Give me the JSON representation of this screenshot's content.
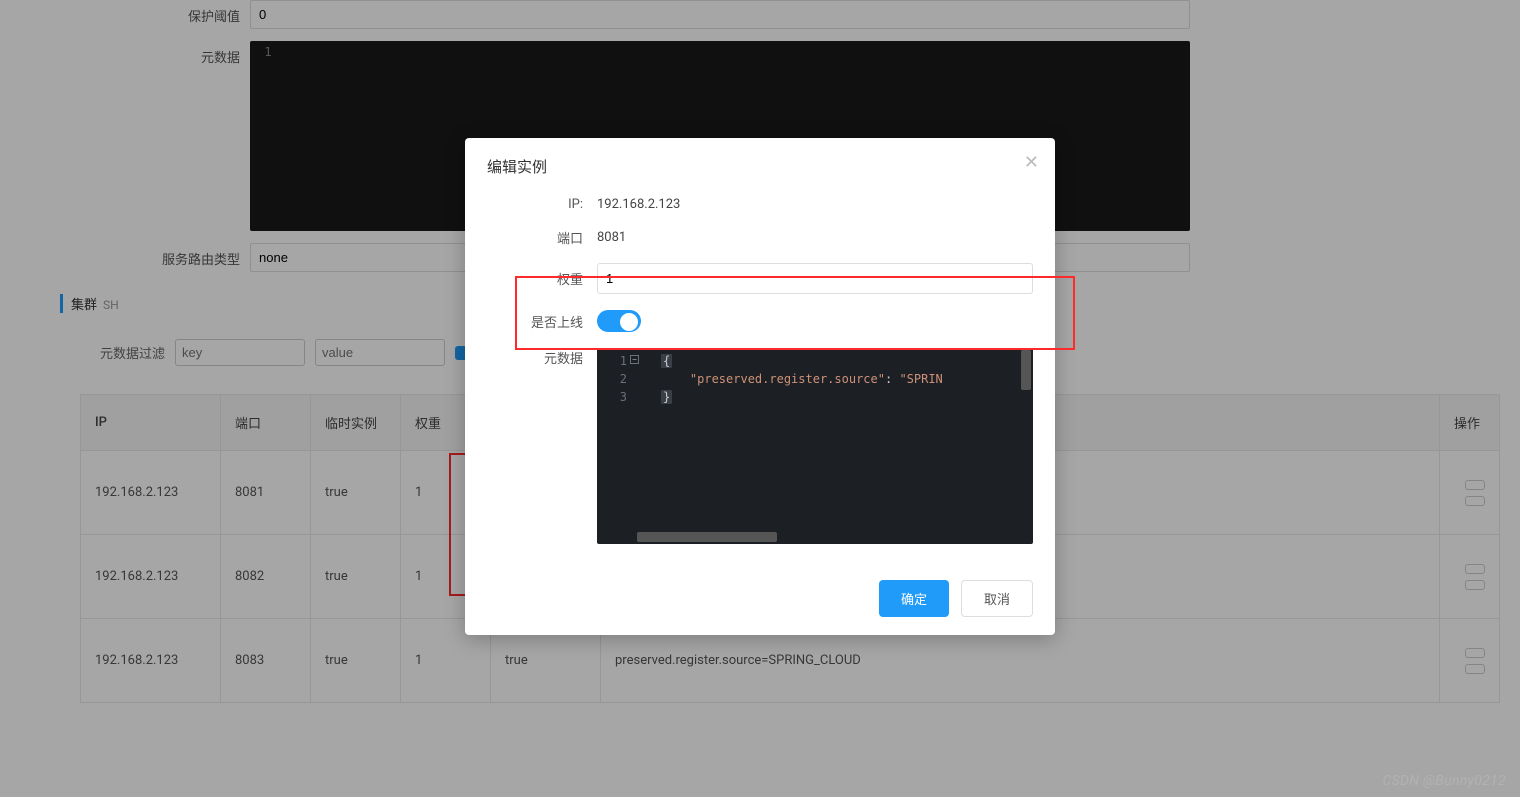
{
  "form": {
    "protect_threshold_label": "保护阈值",
    "protect_threshold_value": "0",
    "metadata_label": "元数据",
    "metadata_line_1": "1",
    "route_type_label": "服务路由类型",
    "route_type_value": "none"
  },
  "cluster": {
    "label": "集群",
    "name": "SH"
  },
  "filter": {
    "label": "元数据过滤",
    "key_placeholder": "key",
    "value_placeholder": "value"
  },
  "table": {
    "headers": {
      "ip": "IP",
      "port": "端口",
      "ephemeral": "临时实例",
      "weight": "权重",
      "healthy": "",
      "metadata": "",
      "ops": "操作"
    },
    "rows": [
      {
        "ip": "192.168.2.123",
        "port": "8081",
        "ephemeral": "true",
        "weight": "1",
        "healthy": "",
        "metadata": ""
      },
      {
        "ip": "192.168.2.123",
        "port": "8082",
        "ephemeral": "true",
        "weight": "1",
        "healthy": "",
        "metadata": ""
      },
      {
        "ip": "192.168.2.123",
        "port": "8083",
        "ephemeral": "true",
        "weight": "1",
        "healthy": "true",
        "metadata": "preserved.register.source=SPRING_CLOUD"
      }
    ]
  },
  "modal": {
    "title": "编辑实例",
    "ip_label": "IP:",
    "ip_value": "192.168.2.123",
    "port_label": "端口",
    "port_value": "8081",
    "weight_label": "权重",
    "weight_value": "1",
    "online_label": "是否上线",
    "metadata_label": "元数据",
    "editor": {
      "line1_num": "1",
      "line1_text": "{",
      "line2_num": "2",
      "line2_key": "\"preserved.register.source\"",
      "line2_sep": ": ",
      "line2_val": "\"SPRIN",
      "line3_num": "3",
      "line3_text": "}"
    },
    "ok": "确定",
    "cancel": "取消"
  },
  "watermark": "CSDN @Bunny0212"
}
